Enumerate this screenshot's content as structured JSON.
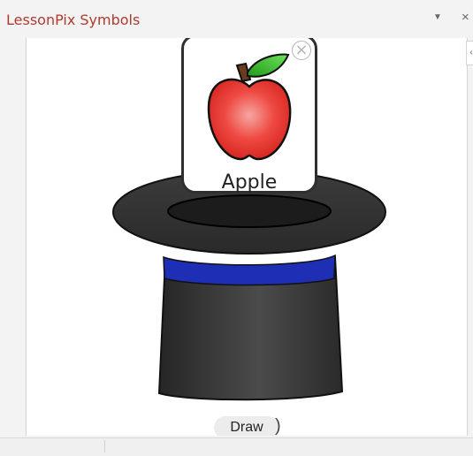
{
  "pane": {
    "title": "LessonPix Symbols",
    "menu_icon": "dropdown-arrow-icon",
    "close_glyph": "×",
    "collapse_glyph": "‹"
  },
  "card": {
    "label": "Apple",
    "close_glyph": "×",
    "image_icon": "apple-icon"
  },
  "draw_button": {
    "label": "Draw",
    "trailing_glyph": ")"
  },
  "colors": {
    "title": "#b03a2e",
    "hat": "#3a3a3a",
    "band": "#1f2fb5",
    "apple": "#e22b25",
    "leaf": "#35c02c"
  }
}
